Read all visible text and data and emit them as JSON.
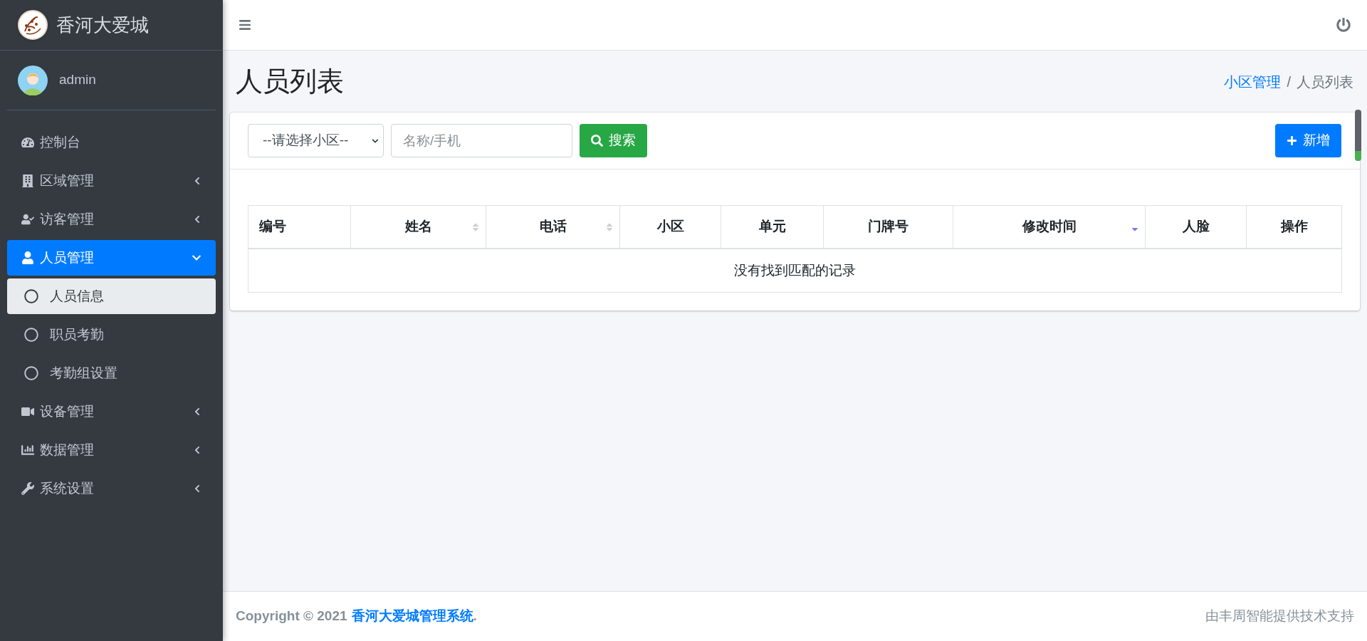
{
  "brand": {
    "title": "香河大爱城"
  },
  "user": {
    "name": "admin"
  },
  "sidebar": {
    "items": [
      {
        "label": "控制台",
        "selected": false
      },
      {
        "label": "区域管理",
        "selected": false,
        "expanded": false
      },
      {
        "label": "访客管理",
        "selected": false,
        "expanded": false
      },
      {
        "label": "人员管理",
        "selected": true,
        "expanded": true,
        "children": [
          {
            "label": "人员信息",
            "selected": true
          },
          {
            "label": "职员考勤",
            "selected": false
          },
          {
            "label": "考勤组设置",
            "selected": false
          }
        ]
      },
      {
        "label": "设备管理",
        "selected": false,
        "expanded": false
      },
      {
        "label": "数据管理",
        "selected": false,
        "expanded": false
      },
      {
        "label": "系统设置",
        "selected": false,
        "expanded": false
      }
    ]
  },
  "page": {
    "title": "人员列表",
    "separator": "/",
    "breadcrumb": [
      {
        "label": "小区管理",
        "kind": "link"
      },
      {
        "label": "人员列表",
        "kind": "current"
      }
    ]
  },
  "toolbar": {
    "select": {
      "value": "--请选择小区--"
    },
    "search": {
      "placeholder": "名称/手机"
    },
    "search_button": "搜索",
    "add_button": "新增"
  },
  "table": {
    "columns": [
      {
        "label": "编号",
        "kind": "plain"
      },
      {
        "label": "姓名",
        "kind": "sortable"
      },
      {
        "label": "电话",
        "kind": "sortable"
      },
      {
        "label": "小区",
        "kind": "plain"
      },
      {
        "label": "单元",
        "kind": "plain"
      },
      {
        "label": "门牌号",
        "kind": "plain"
      },
      {
        "label": "修改时间",
        "kind": "descending"
      },
      {
        "label": "人脸",
        "kind": "plain"
      },
      {
        "label": "操作",
        "kind": "plain"
      }
    ],
    "empty_message": "没有找到匹配的记录"
  },
  "footer": {
    "copyright": "Copyright © 2021",
    "link": "香河大爱城管理系统",
    "end": ".",
    "support": "由丰周智能提供技术支持"
  }
}
